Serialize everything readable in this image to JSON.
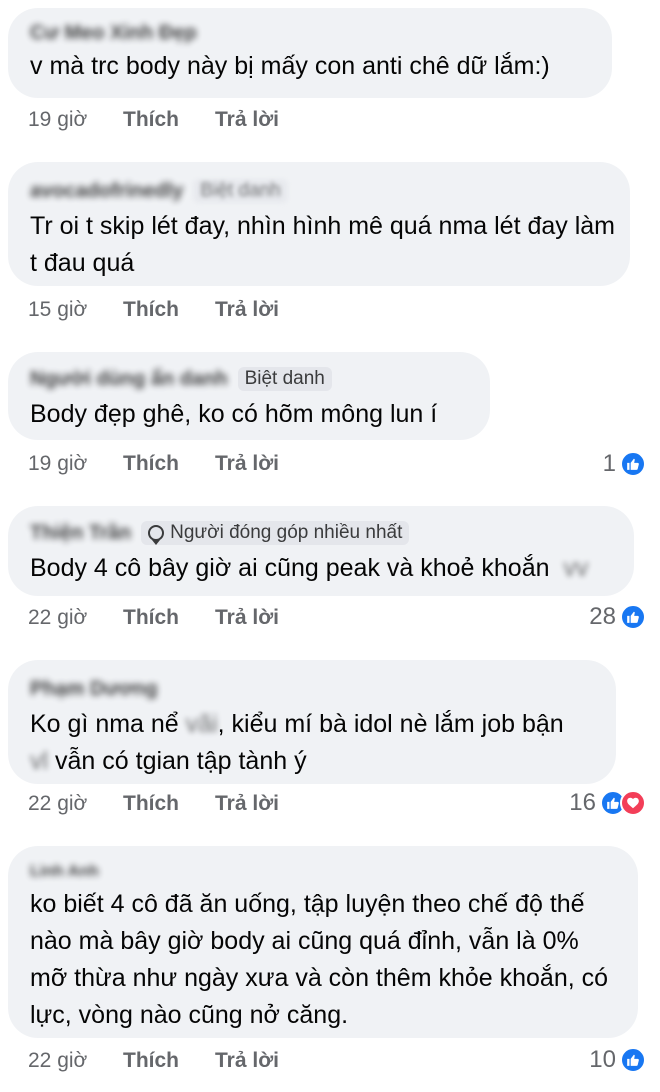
{
  "comments": [
    {
      "author": "Cư Meo Xinh Đẹp",
      "badge": "",
      "text": "v mà trc body này bị mấy con anti chê dữ lắm:)",
      "time": "19 giờ",
      "like_label": "Thích",
      "reply_label": "Trả lời",
      "reaction_count": ""
    },
    {
      "author": "avocadofrinedly",
      "badge": "Biệt danh",
      "text": "Tr oi t skip lét đay, nhìn hình mê quá nma lét đay làm t đau quá",
      "time": "15 giờ",
      "like_label": "Thích",
      "reply_label": "Trả lời",
      "reaction_count": ""
    },
    {
      "author": "Người dùng ẩn danh",
      "badge": "Biệt danh",
      "text": "Body đẹp ghê, ko có hõm mông lun í",
      "time": "19 giờ",
      "like_label": "Thích",
      "reply_label": "Trả lời",
      "reaction_count": "1"
    },
    {
      "author": "Thiện Trần",
      "badge": "Người đóng góp nhiều nhất",
      "text": "Body 4 cô bây giờ ai cũng peak và khoẻ khoắn",
      "time": "22 giờ",
      "like_label": "Thích",
      "reply_label": "Trả lời",
      "reaction_count": "28"
    },
    {
      "author": "Phạm Dương",
      "badge": "",
      "text_a": "Ko gì nma nể",
      "text_b": "kiểu mí bà idol nè lắm job bận",
      "text_c": "vẫn có tgian tập tành ý",
      "time": "22 giờ",
      "like_label": "Thích",
      "reply_label": "Trả lời",
      "reaction_count": "16"
    },
    {
      "author": "Linh Anh",
      "badge": "",
      "text": "ko biết 4 cô đã ăn uống, tập luyện theo chế độ thế nào mà bây giờ body ai cũng quá đỉnh, vẫn là 0% mỡ thừa như ngày xưa và còn thêm khỏe khoắn, có lực, vòng nào cũng nở căng.",
      "time": "22 giờ",
      "like_label": "Thích",
      "reply_label": "Trả lời",
      "reaction_count": "10"
    }
  ],
  "icons": {
    "like": "thumbs-up-icon",
    "love": "heart-icon",
    "contributor": "top-contributor-icon"
  },
  "colors": {
    "bubble": "#f0f2f5",
    "meta": "#65676b",
    "like_blue": "#1877f2",
    "love_red": "#f33e58"
  }
}
